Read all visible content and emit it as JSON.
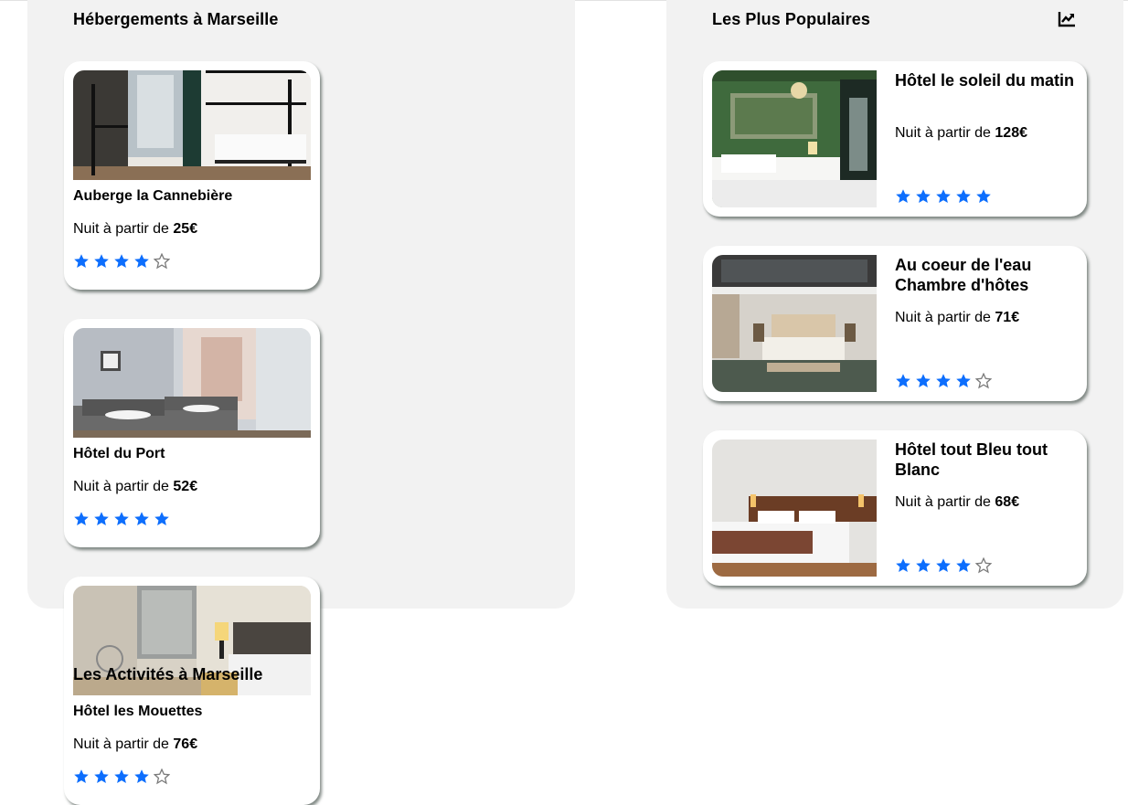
{
  "colors": {
    "star_filled": "#0d6efd",
    "star_empty": "#7a7a7a",
    "panel_bg": "#f2f2f2"
  },
  "left_section": {
    "title": "Hébergements à Marseille",
    "cards": [
      {
        "name": "Auberge la Cannebière",
        "price_prefix": "Nuit à partir de ",
        "price": "25€",
        "rating": 4,
        "image": "hostel-bunk-room-photo"
      },
      {
        "name": "Hôtel du Port",
        "price_prefix": "Nuit à partir de ",
        "price": "52€",
        "rating": 5,
        "image": "twin-bed-room-photo"
      },
      {
        "name": "Hôtel les Mouettes",
        "price_prefix": "Nuit à partir de ",
        "price": "76€",
        "rating": 4,
        "image": "modern-bedroom-photo"
      }
    ]
  },
  "right_section": {
    "title": "Les Plus Populaires",
    "icon": "trending-up-icon",
    "cards": [
      {
        "name": "Hôtel le soleil du matin",
        "price_prefix": "Nuit à partir de ",
        "price": "128€",
        "rating": 5,
        "image": "green-wall-bedroom-photo"
      },
      {
        "name": "Au coeur de l'eau Chambre d'hôtes",
        "price_prefix": "Nuit à partir de ",
        "price": "71€",
        "rating": 4,
        "image": "loft-bedroom-photo"
      },
      {
        "name": "Hôtel tout Bleu tout Blanc",
        "price_prefix": "Nuit à partir de ",
        "price": "68€",
        "rating": 4,
        "image": "wood-headboard-bedroom-photo"
      }
    ]
  },
  "activities_heading": "Les Activités à Marseille"
}
